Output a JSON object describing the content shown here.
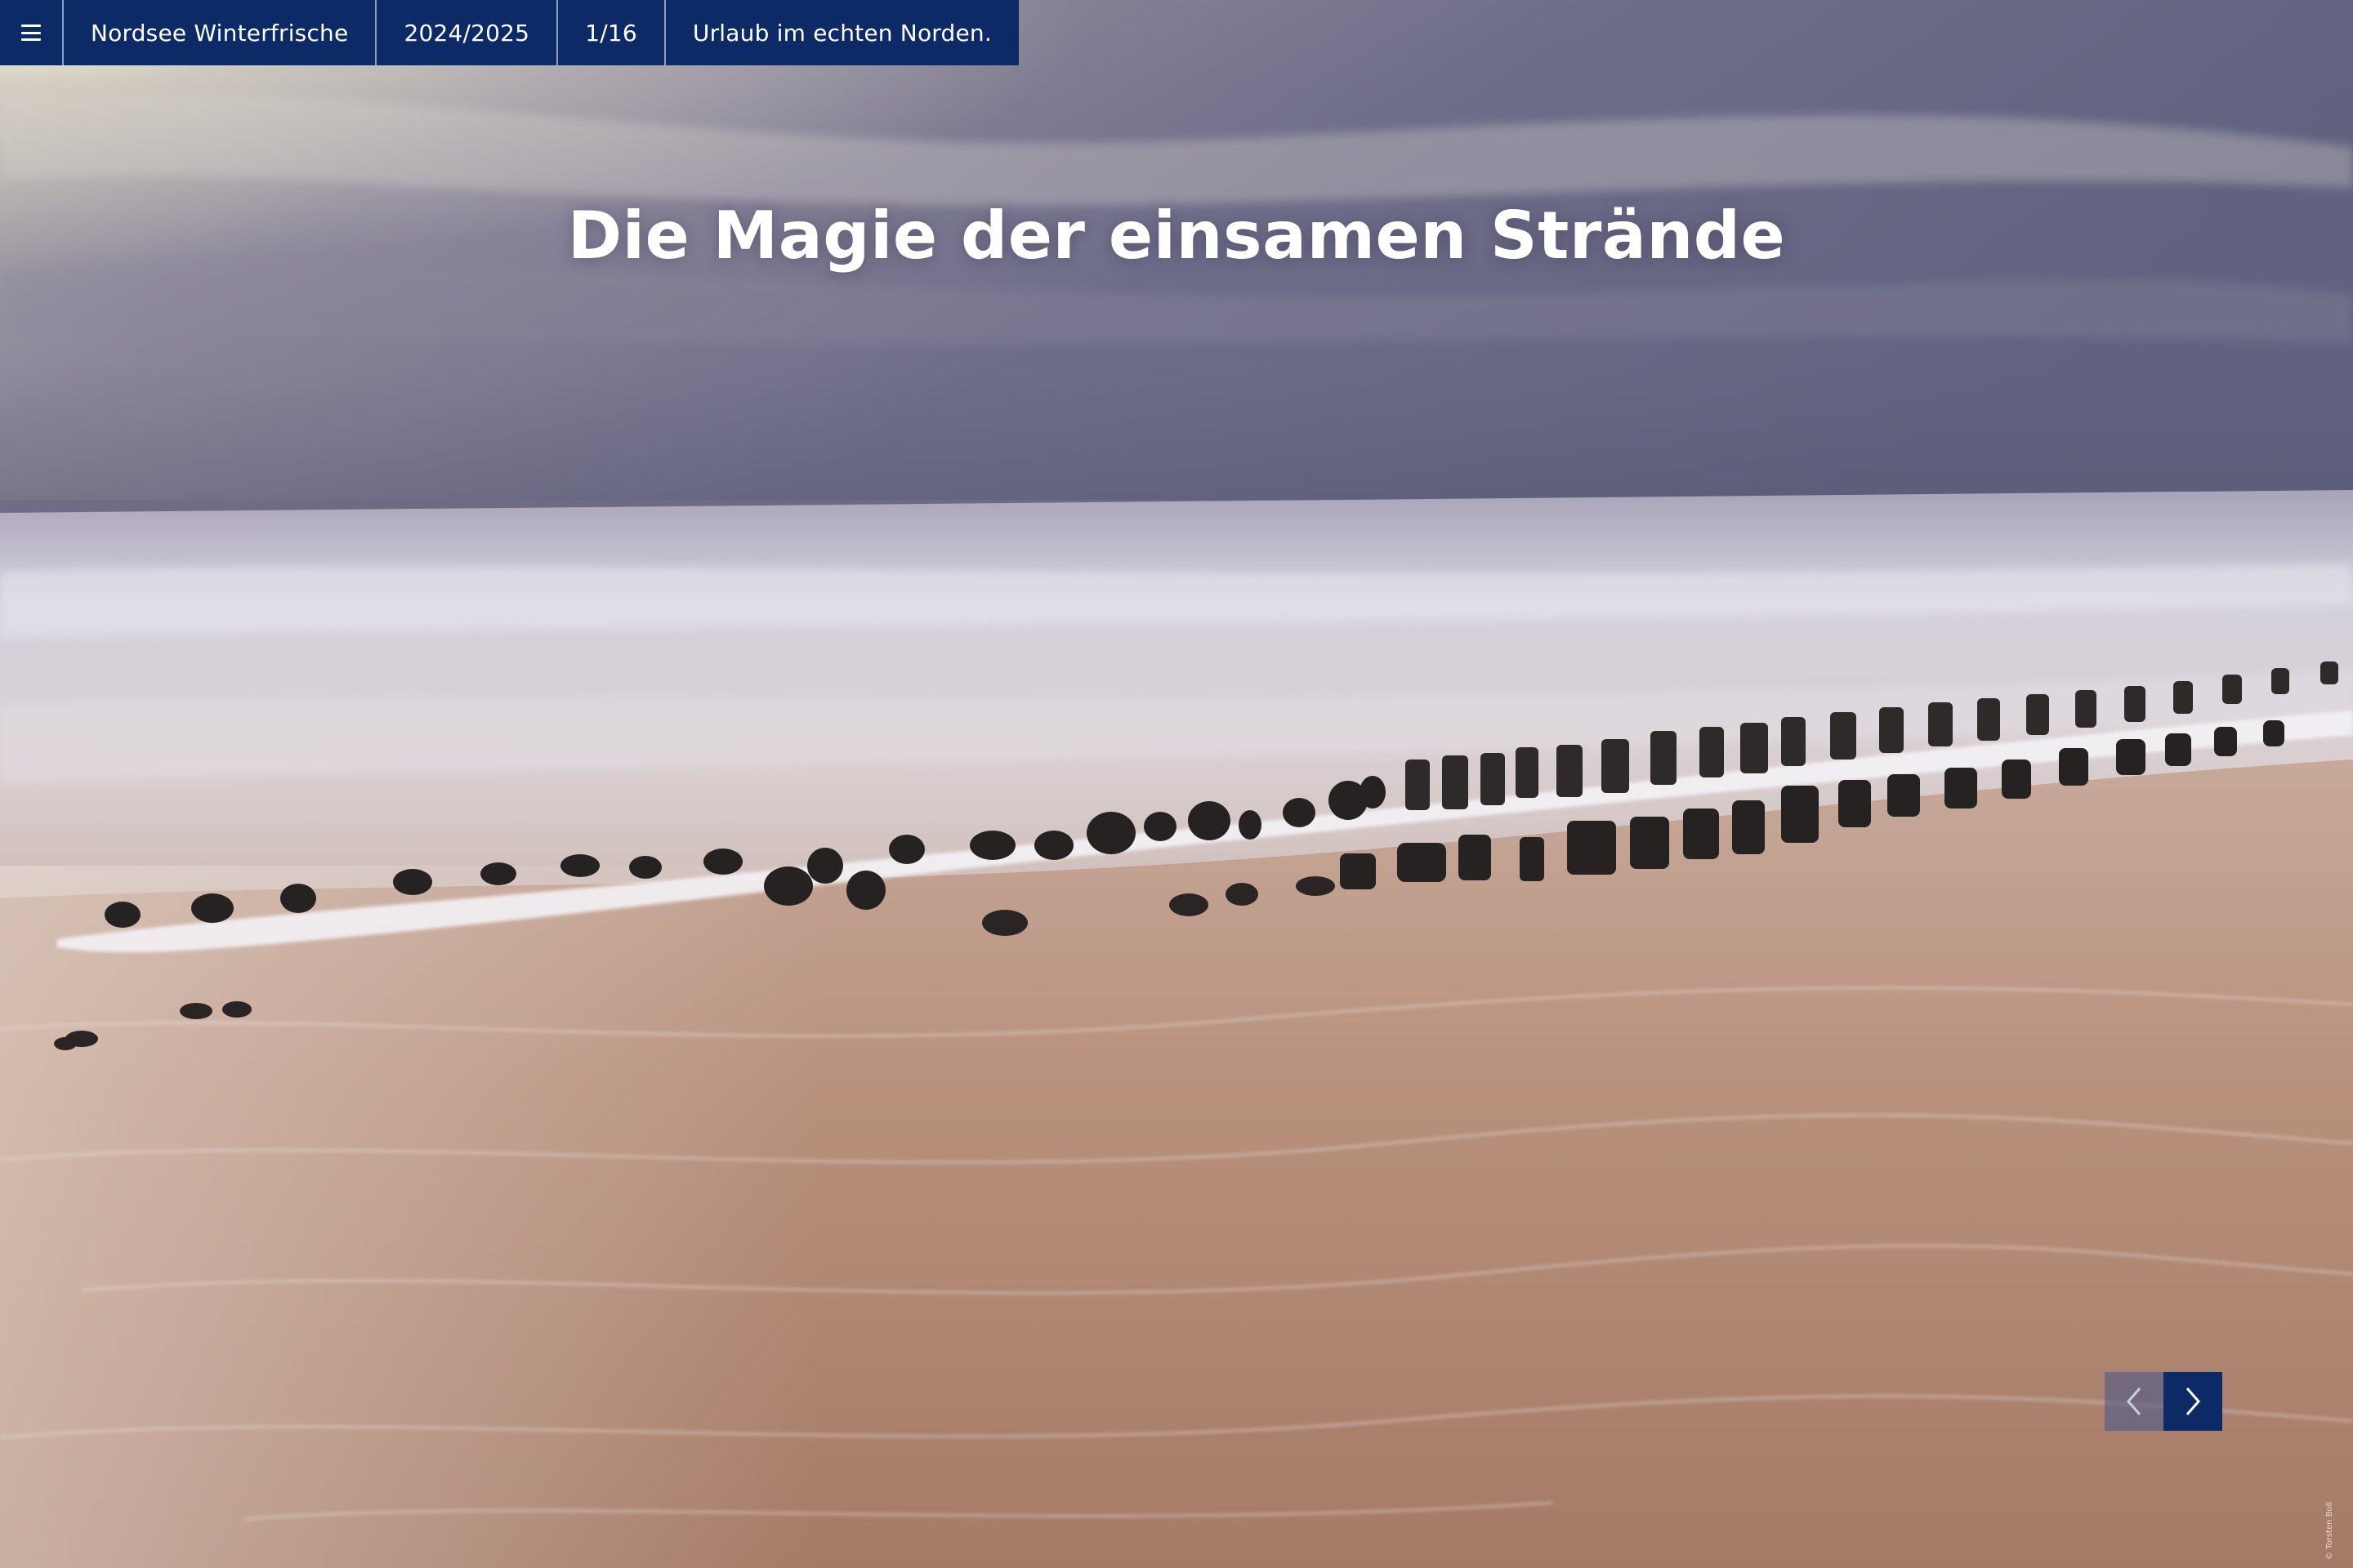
{
  "topbar": {
    "menu_icon": "hamburger-menu-icon",
    "brand": "Nordsee Winterfrische",
    "season": "2024/2025",
    "page_indicator": "1/16",
    "tagline": "Urlaub im echten Norden."
  },
  "hero": {
    "headline": "Die Magie der einsamen Strände"
  },
  "pager": {
    "prev_icon": "chevron-left-icon",
    "next_icon": "chevron-right-icon"
  },
  "credit": "© Torsten Boll",
  "colors": {
    "nav_background": "#0b2a66",
    "nav_text": "#ffffff",
    "headline_text": "#ffffff"
  }
}
